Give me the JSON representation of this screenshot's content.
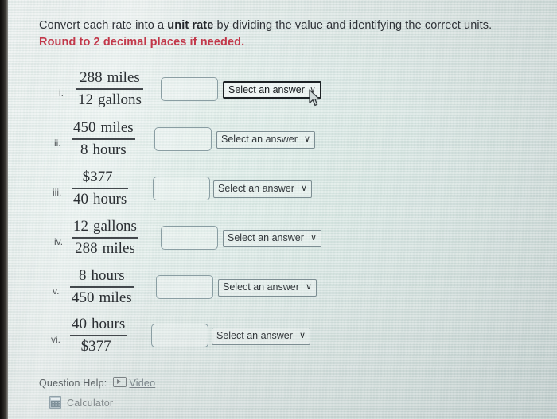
{
  "prompt": {
    "line1_a": "Convert each rate into a ",
    "line1_b": "unit rate",
    "line1_c": " by dividing the value and identifying the correct units.",
    "line2": "Round to 2 decimal places if needed."
  },
  "select_label": "Select an answer",
  "caret_glyph": "∨",
  "rows": [
    {
      "num_label": "i.",
      "numerator_value": "288",
      "numerator_unit": "miles",
      "denominator_value": "12",
      "denominator_unit": "gallons",
      "answer_value": "",
      "select_text": "Select an answer",
      "focused": true
    },
    {
      "num_label": "ii.",
      "numerator_value": "450",
      "numerator_unit": "miles",
      "denominator_value": "8",
      "denominator_unit": "hours",
      "answer_value": "",
      "select_text": "Select an answer",
      "focused": false
    },
    {
      "num_label": "iii.",
      "numerator_value": "$377",
      "numerator_unit": "",
      "denominator_value": "40",
      "denominator_unit": "hours",
      "answer_value": "",
      "select_text": "Select an answer",
      "focused": false
    },
    {
      "num_label": "iv.",
      "numerator_value": "12",
      "numerator_unit": "gallons",
      "denominator_value": "288",
      "denominator_unit": "miles",
      "answer_value": "",
      "select_text": "Select an answer",
      "focused": false
    },
    {
      "num_label": "v.",
      "numerator_value": "8",
      "numerator_unit": "hours",
      "denominator_value": "450",
      "denominator_unit": "miles",
      "answer_value": "",
      "select_text": "Select an answer",
      "focused": false
    },
    {
      "num_label": "vi.",
      "numerator_value": "40",
      "numerator_unit": "hours",
      "denominator_value": "$377",
      "denominator_unit": "",
      "answer_value": "",
      "select_text": "Select an answer",
      "focused": false
    }
  ],
  "footer": {
    "question_help_label": "Question Help:",
    "video_link": "Video",
    "calculator_label": "Calculator"
  },
  "colors": {
    "warning_text": "#c2384a",
    "body_text": "#2f3338",
    "field_border": "#8a9ea3",
    "focused_border": "#1d2225",
    "link": "#7b848a"
  }
}
